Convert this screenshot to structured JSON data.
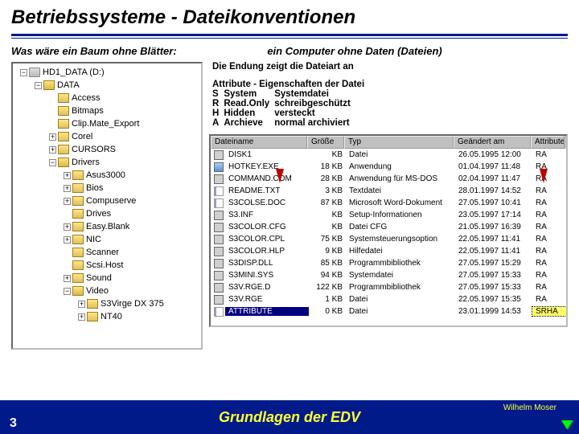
{
  "title": "Betriebssysteme - Dateikonventionen",
  "sub_left": "Was wäre ein Baum ohne Blätter:",
  "sub_right": "ein Computer ohne Daten (Dateien)",
  "desc": {
    "l1a": "Die Endung zeigt die",
    "l1b": "Dateiart",
    "l1c": "an",
    "l2a": "Attribute -",
    "l2b": "Eigenschaften der Datei",
    "rows": [
      {
        "k": "S",
        "a": "System",
        "b": "Systemdatei"
      },
      {
        "k": "R",
        "a": "Read.Only",
        "b": "schreibgeschützt"
      },
      {
        "k": "H",
        "a": "Hidden",
        "b": "versteckt"
      },
      {
        "k": "A",
        "a": "Archieve",
        "b": "normal archiviert"
      }
    ]
  },
  "tree": [
    {
      "ind": 0,
      "pm": "-",
      "ico": "drive",
      "label": "HD1_DATA (D:)"
    },
    {
      "ind": 1,
      "pm": "-",
      "ico": "folder-o",
      "label": "DATA"
    },
    {
      "ind": 2,
      "pm": "",
      "ico": "folder-c",
      "label": "Access"
    },
    {
      "ind": 2,
      "pm": "",
      "ico": "folder-c",
      "label": "Bitmaps"
    },
    {
      "ind": 2,
      "pm": "",
      "ico": "folder-c",
      "label": "Clip.Mate_Export"
    },
    {
      "ind": 2,
      "pm": "+",
      "ico": "folder-c",
      "label": "Corel"
    },
    {
      "ind": 2,
      "pm": "+",
      "ico": "folder-c",
      "label": "CURSORS"
    },
    {
      "ind": 2,
      "pm": "-",
      "ico": "folder-o",
      "label": "Drivers"
    },
    {
      "ind": 3,
      "pm": "+",
      "ico": "folder-c",
      "label": "Asus3000"
    },
    {
      "ind": 3,
      "pm": "+",
      "ico": "folder-c",
      "label": "Bios"
    },
    {
      "ind": 3,
      "pm": "+",
      "ico": "folder-c",
      "label": "Compuserve"
    },
    {
      "ind": 3,
      "pm": "",
      "ico": "folder-c",
      "label": "Drives"
    },
    {
      "ind": 3,
      "pm": "+",
      "ico": "folder-c",
      "label": "Easy.Blank"
    },
    {
      "ind": 3,
      "pm": "+",
      "ico": "folder-c",
      "label": "NIC"
    },
    {
      "ind": 3,
      "pm": "",
      "ico": "folder-c",
      "label": "Scanner"
    },
    {
      "ind": 3,
      "pm": "",
      "ico": "folder-c",
      "label": "Scsi.Host"
    },
    {
      "ind": 3,
      "pm": "+",
      "ico": "folder-c",
      "label": "Sound"
    },
    {
      "ind": 3,
      "pm": "-",
      "ico": "folder-o",
      "label": "Video"
    },
    {
      "ind": 4,
      "pm": "+",
      "ico": "folder-c",
      "label": "S3Virge DX 375"
    },
    {
      "ind": 4,
      "pm": "+",
      "ico": "folder-c",
      "label": "NT40"
    }
  ],
  "cols": {
    "name": "Dateiname",
    "size": "Größe",
    "type": "Typ",
    "date": "Geändert am",
    "attr": "Attribute"
  },
  "files": [
    {
      "ico": "sys",
      "name": "DISK1",
      "size": "KB",
      "type": "Datei",
      "date": "26.05.1995 12:00",
      "attr": "RA"
    },
    {
      "ico": "exe",
      "name": "HOTKEY.EXE",
      "size": "18 KB",
      "type": "Anwendung",
      "date": "01.04.1997 11:48",
      "attr": "RA"
    },
    {
      "ico": "sys",
      "name": "COMMAND.COM",
      "size": "28 KB",
      "type": "Anwendung für MS-DOS",
      "date": "02.04.1997 11:47",
      "attr": "RA"
    },
    {
      "ico": "txt",
      "name": "README.TXT",
      "size": "3 KB",
      "type": "Textdatei",
      "date": "28.01.1997 14:52",
      "attr": "RA"
    },
    {
      "ico": "txt",
      "name": "S3COLSE.DOC",
      "size": "87 KB",
      "type": "Microsoft Word-Dokument",
      "date": "27.05.1997 10:41",
      "attr": "RA"
    },
    {
      "ico": "sys",
      "name": "S3.INF",
      "size": "KB",
      "type": "Setup-Informationen",
      "date": "23.05.1997 17:14",
      "attr": "RA"
    },
    {
      "ico": "sys",
      "name": "S3COLOR.CFG",
      "size": "KB",
      "type": "Datei CFG",
      "date": "21.05.1997 16:39",
      "attr": "RA"
    },
    {
      "ico": "sys",
      "name": "S3COLOR.CPL",
      "size": "75 KB",
      "type": "Systemsteuerungsoption",
      "date": "22.05.1997 11:41",
      "attr": "RA"
    },
    {
      "ico": "sys",
      "name": "S3COLOR.HLP",
      "size": "9 KB",
      "type": "Hilfedatei",
      "date": "22.05.1997 11:41",
      "attr": "RA"
    },
    {
      "ico": "sys",
      "name": "S3DISP.DLL",
      "size": "85 KB",
      "type": "Programmbibliothek",
      "date": "27.05.1997 15:29",
      "attr": "RA"
    },
    {
      "ico": "sys",
      "name": "S3MINI.SYS",
      "size": "94 KB",
      "type": "Systemdatei",
      "date": "27.05.1997 15:33",
      "attr": "RA"
    },
    {
      "ico": "sys",
      "name": "S3V.RGE.D",
      "size": "122 KB",
      "type": "Programmbibliothek",
      "date": "27.05.1997 15:33",
      "attr": "RA"
    },
    {
      "ico": "sys",
      "name": "S3V.RGE",
      "size": "1 KB",
      "type": "Datei",
      "date": "22.05.1997 15:35",
      "attr": "RA"
    },
    {
      "ico": "txt",
      "name": "ATTRIBUTE",
      "size": "0 KB",
      "type": "Datei",
      "date": "23.01.1999 14:53",
      "attr": "SRHA",
      "sel": true,
      "attrhi": true
    }
  ],
  "footer": {
    "page": "3",
    "title": "Grundlagen der EDV",
    "author": "Wilhelm Moser"
  }
}
